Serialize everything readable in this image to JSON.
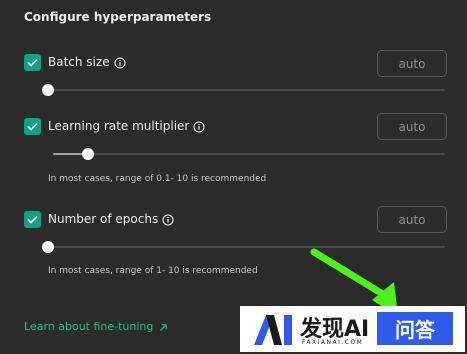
{
  "panel": {
    "title": "Configure hyperparameters"
  },
  "hyperparameters": [
    {
      "label": "Batch size",
      "checked": true,
      "value": "auto",
      "slider_fraction": 0.0,
      "hint": ""
    },
    {
      "label": "Learning rate multiplier",
      "checked": true,
      "value": "auto",
      "slider_fraction": 0.09,
      "hint": "In most cases, range of 0.1- 10 is recommended"
    },
    {
      "label": "Number of epochs",
      "checked": true,
      "value": "auto",
      "slider_fraction": 0.0,
      "hint": "In most cases, range of 1- 10 is recommended"
    }
  ],
  "learn_link": {
    "label": "Learn about fine-tuning",
    "icon": "external-arrow-icon"
  },
  "watermark": {
    "brand": "发现AI",
    "site": "FAXIANAI.COM",
    "badge": "问答"
  },
  "colors": {
    "accent": "#10a37f",
    "link": "#19c37d",
    "arrow": "#4cf21a",
    "watermark_blue": "#2f5bea"
  }
}
